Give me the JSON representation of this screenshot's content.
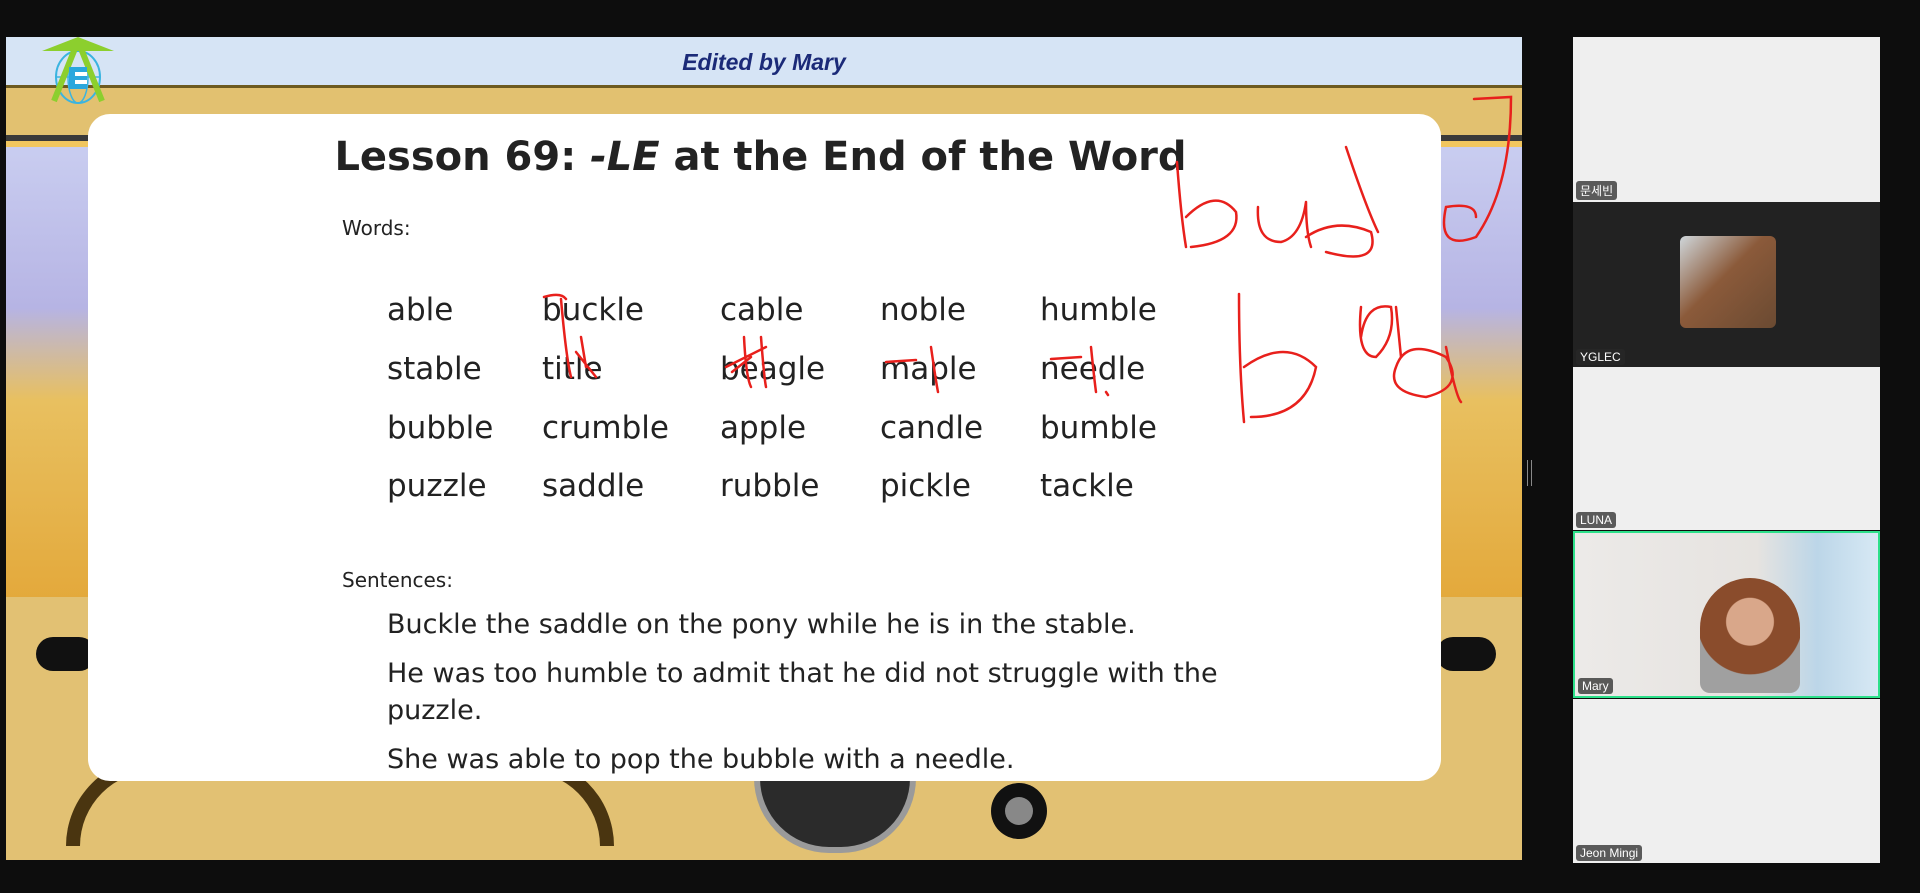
{
  "slide": {
    "header_title": "Edited by Mary",
    "logo_icon": "e-globe-arrow-logo",
    "lesson_title_prefix": "Lesson 69: ",
    "lesson_title_em": "-LE",
    "lesson_title_suffix": " at the End of the Word",
    "words_label": "Words:",
    "words": [
      [
        "able",
        "buckle",
        "cable",
        "noble",
        "humble"
      ],
      [
        "stable",
        "title",
        "beagle",
        "maple",
        "needle"
      ],
      [
        "bubble",
        "crumble",
        "apple",
        "candle",
        "bumble"
      ],
      [
        "puzzle",
        "saddle",
        "rubble",
        "pickle",
        "tackle"
      ]
    ],
    "sentences_label": "Sentences:",
    "sentences": [
      "Buckle the saddle on the pony while he is in the stable.",
      "He was too humble to admit that he did not struggle with the puzzle.",
      "She was able to pop the bubble with a needle."
    ],
    "annotation_color": "#e8201c"
  },
  "participants": [
    {
      "name": "문세빈",
      "video": false
    },
    {
      "name": "YGLEC",
      "video": true
    },
    {
      "name": "LUNA",
      "video": false
    },
    {
      "name": "Mary",
      "video": true,
      "active_speaker": true
    },
    {
      "name": "Jeon Mingi",
      "video": false
    }
  ],
  "colors": {
    "active_speaker_border": "#2de08a",
    "header_text": "#1b2a78"
  }
}
